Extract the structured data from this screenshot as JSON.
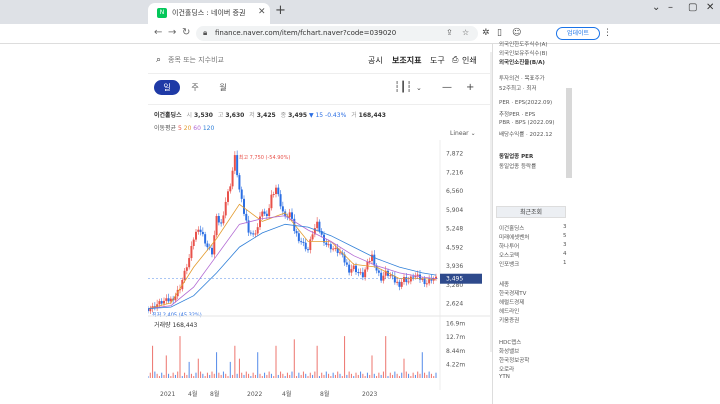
{
  "browser": {
    "tab_title": "이건홀딩스 : 네이버 증권",
    "favicon_text": "N",
    "url": "finance.naver.com/item/fchart.naver?code=039020",
    "update_label": "업데이트"
  },
  "toolbar": {
    "search_placeholder": "종목 또는 지수비교",
    "menu": [
      "공시",
      "보조지표",
      "도구",
      "인쇄"
    ]
  },
  "periods": [
    "일",
    "주",
    "월"
  ],
  "active_period": "일",
  "stock": {
    "name": "이건홀딩스",
    "open_label": "시",
    "open": "3,530",
    "high_label": "고",
    "high": "3,630",
    "low_label": "저",
    "low": "3,425",
    "close_label": "종",
    "close": "3,495",
    "change": "▼ 15",
    "change_pct": "-0.43%",
    "volume_label": "거",
    "volume": "168,443"
  },
  "ma_legend": {
    "label": "이동평균",
    "items": [
      {
        "text": "5",
        "color": "#e8514a"
      },
      {
        "text": "20",
        "color": "#e39b2e"
      },
      {
        "text": "60",
        "color": "#b26ad3"
      },
      {
        "text": "120",
        "color": "#2f7fd8"
      }
    ]
  },
  "scale_label": "Linear",
  "volume_caption": {
    "label": "거래량",
    "value": "168,443"
  },
  "annotations": {
    "high": "최고 7,750 (-54.90%)",
    "low": "최저 2,405 (45.32%)"
  },
  "chart_data": {
    "type": "candlestick",
    "price_axis_ticks": [
      "7,872",
      "7,216",
      "6,560",
      "5,904",
      "5,248",
      "4,592",
      "3,936",
      "3,280",
      "2,624"
    ],
    "current_price_tag": "3,495",
    "volume_axis_ticks": [
      "16.9m",
      "12.7m",
      "8.44m",
      "4.22m"
    ],
    "x_ticks": [
      "2021",
      "4월",
      "8월",
      "2022",
      "4월",
      "8월",
      "2023"
    ],
    "ylim": [
      2400,
      8000
    ],
    "price_path": [
      [
        0,
        2450
      ],
      [
        2,
        2480
      ],
      [
        4,
        2600
      ],
      [
        6,
        2680
      ],
      [
        8,
        2720
      ],
      [
        10,
        2760
      ],
      [
        12,
        2900
      ],
      [
        14,
        3200
      ],
      [
        16,
        3700
      ],
      [
        18,
        4200
      ],
      [
        20,
        4900
      ],
      [
        22,
        5300
      ],
      [
        24,
        5000
      ],
      [
        26,
        4600
      ],
      [
        28,
        4400
      ],
      [
        30,
        5600
      ],
      [
        32,
        5400
      ],
      [
        34,
        6200
      ],
      [
        36,
        6800
      ],
      [
        38,
        7750
      ],
      [
        40,
        6600
      ],
      [
        42,
        5800
      ],
      [
        44,
        5200
      ],
      [
        46,
        5000
      ],
      [
        48,
        5300
      ],
      [
        50,
        5900
      ],
      [
        52,
        5600
      ],
      [
        54,
        6400
      ],
      [
        56,
        6700
      ],
      [
        58,
        6100
      ],
      [
        60,
        5600
      ],
      [
        62,
        5800
      ],
      [
        64,
        5200
      ],
      [
        66,
        4900
      ],
      [
        68,
        4700
      ],
      [
        70,
        4500
      ],
      [
        72,
        5100
      ],
      [
        74,
        5400
      ],
      [
        76,
        5000
      ],
      [
        78,
        4700
      ],
      [
        80,
        4600
      ],
      [
        82,
        4500
      ],
      [
        84,
        4400
      ],
      [
        86,
        4100
      ],
      [
        88,
        3800
      ],
      [
        90,
        3900
      ],
      [
        92,
        3700
      ],
      [
        94,
        3600
      ],
      [
        96,
        4000
      ],
      [
        98,
        4300
      ],
      [
        100,
        3800
      ],
      [
        102,
        3500
      ],
      [
        104,
        3700
      ],
      [
        106,
        3600
      ],
      [
        108,
        3400
      ],
      [
        110,
        3300
      ],
      [
        112,
        3500
      ],
      [
        114,
        3400
      ],
      [
        116,
        3600
      ],
      [
        118,
        3550
      ],
      [
        120,
        3450
      ],
      [
        122,
        3350
      ],
      [
        124,
        3500
      ],
      [
        126,
        3495
      ]
    ],
    "ma_paths": [
      {
        "name": "20",
        "color": "#e39b2e",
        "values": [
          [
            0,
            2450
          ],
          [
            10,
            2650
          ],
          [
            20,
            3900
          ],
          [
            30,
            4900
          ],
          [
            40,
            6100
          ],
          [
            50,
            5500
          ],
          [
            60,
            5800
          ],
          [
            70,
            4800
          ],
          [
            80,
            4800
          ],
          [
            90,
            4000
          ],
          [
            100,
            3900
          ],
          [
            110,
            3500
          ],
          [
            120,
            3500
          ],
          [
            126,
            3480
          ]
        ]
      },
      {
        "name": "60",
        "color": "#b26ad3",
        "values": [
          [
            0,
            2450
          ],
          [
            10,
            2550
          ],
          [
            20,
            3200
          ],
          [
            30,
            4300
          ],
          [
            40,
            5400
          ],
          [
            50,
            5600
          ],
          [
            60,
            5700
          ],
          [
            70,
            5200
          ],
          [
            80,
            4800
          ],
          [
            90,
            4300
          ],
          [
            100,
            3950
          ],
          [
            110,
            3700
          ],
          [
            120,
            3550
          ],
          [
            126,
            3500
          ]
        ]
      },
      {
        "name": "120",
        "color": "#2f7fd8",
        "values": [
          [
            0,
            2450
          ],
          [
            10,
            2500
          ],
          [
            20,
            2900
          ],
          [
            30,
            3700
          ],
          [
            40,
            4600
          ],
          [
            50,
            5100
          ],
          [
            60,
            5400
          ],
          [
            70,
            5300
          ],
          [
            80,
            5000
          ],
          [
            90,
            4600
          ],
          [
            100,
            4200
          ],
          [
            110,
            3900
          ],
          [
            120,
            3700
          ],
          [
            126,
            3620
          ]
        ]
      }
    ],
    "volume_spikes": [
      2,
      8,
      14,
      18,
      22,
      30,
      36,
      38,
      40,
      48,
      56,
      64,
      74,
      86,
      98,
      104,
      112,
      120
    ]
  },
  "sidebar": {
    "top_items": [
      "외국인한도주식수(A)",
      "외국인보유주식수(B)",
      "외국인소진율(B/A)"
    ],
    "info_items": [
      "투자의견 · 목표주가",
      "52주최고 · 최저"
    ],
    "metric_items": [
      "PER · EPS(2022.09)",
      "추정PER · EPS",
      "PBR · BPS (2022.09)",
      "배당수익률 · 2022.12"
    ],
    "sector_items": [
      "동일업종 PER",
      "동일업종 등락률"
    ],
    "recent_tab": "최근조회",
    "recent_items": [
      "이건홀딩스",
      "미래에셋벤처",
      "하나투어",
      "오스코텍",
      "인포뱅크"
    ],
    "recent_nums": [
      "3",
      "5",
      "3",
      "4",
      "1"
    ],
    "news_items": [
      "세종",
      "한국경제TV",
      "헤럴드경제",
      "헤드라인",
      "키움증권"
    ],
    "news_items2": [
      "HDC랩스",
      "화성밸브",
      "한국정보공학",
      "오로라",
      "YTN"
    ]
  }
}
